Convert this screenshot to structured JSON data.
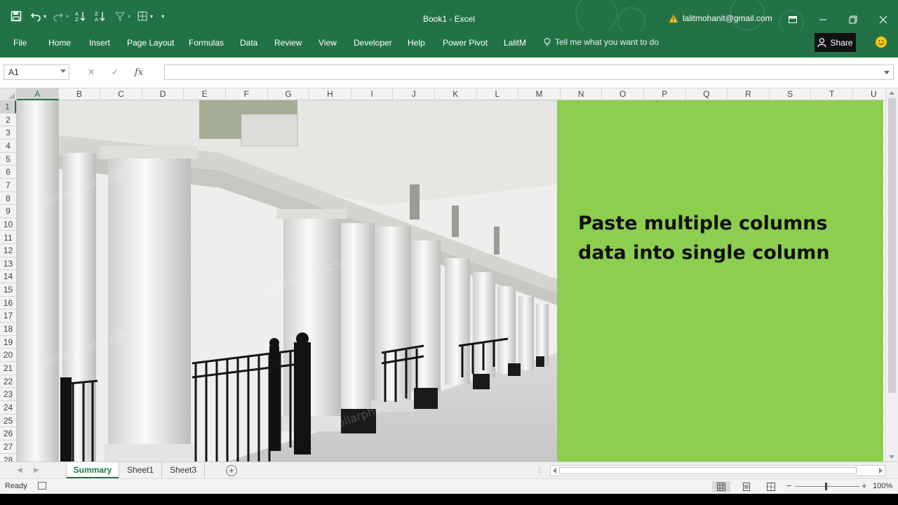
{
  "window": {
    "title": "Book1 - Excel",
    "user_email": "lalitmohanit@gmail.com",
    "brand_color": "#217346"
  },
  "ribbon": {
    "tabs": [
      "File",
      "Home",
      "Insert",
      "Page Layout",
      "Formulas",
      "Data",
      "Review",
      "View",
      "Developer",
      "Help",
      "Power Pivot",
      "LalitM"
    ],
    "tell_me": "Tell me what you want to do",
    "share_label": "Share"
  },
  "formula_bar": {
    "name_box": "A1",
    "formula": "",
    "fx_label": "fx"
  },
  "grid": {
    "columns": [
      "A",
      "B",
      "C",
      "D",
      "E",
      "F",
      "G",
      "H",
      "I",
      "J",
      "K",
      "L",
      "M",
      "N",
      "O",
      "P",
      "Q",
      "R",
      "S",
      "T",
      "U"
    ],
    "rows": [
      "1",
      "2",
      "3",
      "4",
      "5",
      "6",
      "7",
      "8",
      "9",
      "10",
      "11",
      "12",
      "13",
      "14",
      "15",
      "16",
      "17",
      "18",
      "19",
      "20",
      "21",
      "22",
      "23",
      "24",
      "25",
      "26",
      "27",
      "28"
    ],
    "selected_cell": "A1"
  },
  "banner": {
    "text": "Paste multiple columns data into single column",
    "background": "#8cce4e"
  },
  "sheets": {
    "tabs": [
      "Summary",
      "Sheet1",
      "Sheet3"
    ],
    "active": "Summary"
  },
  "status_bar": {
    "ready": "Ready",
    "zoom": "100%"
  }
}
